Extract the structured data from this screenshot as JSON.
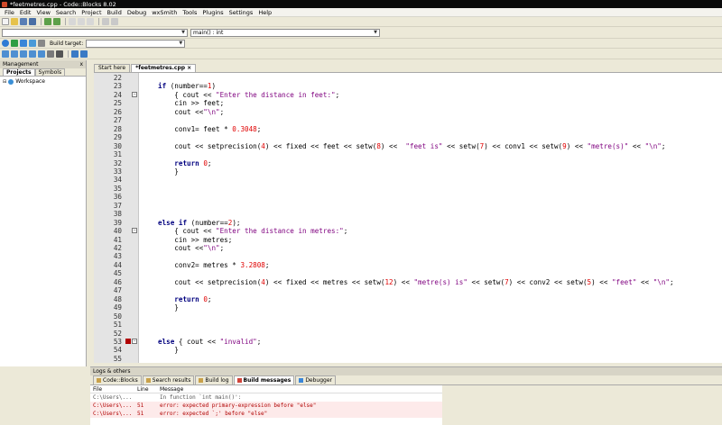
{
  "window": {
    "title": "*feetmetres.cpp - Code::Blocks 8.02"
  },
  "menu": [
    "File",
    "Edit",
    "View",
    "Search",
    "Project",
    "Build",
    "Debug",
    "wxSmith",
    "Tools",
    "Plugins",
    "Settings",
    "Help"
  ],
  "toolbar": {
    "build_target_label": "Build target:",
    "symbol_combo": "main() : int"
  },
  "management": {
    "title": "Management",
    "close": "x",
    "tabs": [
      "Projects",
      "Symbols"
    ],
    "workspace": "Workspace"
  },
  "editor": {
    "tabs": [
      {
        "label": "Start here"
      },
      {
        "label": "*feetmetres.cpp ×"
      }
    ],
    "lines": [
      {
        "n": "22",
        "t": ""
      },
      {
        "n": "23",
        "t": "if (number==1)"
      },
      {
        "n": "24",
        "t": "    { cout << \"Enter the distance in feet:\";"
      },
      {
        "n": "25",
        "t": "    cin >> feet;"
      },
      {
        "n": "26",
        "t": "    cout <<\"\\n\";"
      },
      {
        "n": "27",
        "t": ""
      },
      {
        "n": "28",
        "t": "    conv1= feet * 0.3048;"
      },
      {
        "n": "29",
        "t": ""
      },
      {
        "n": "30",
        "t": "    cout << setprecision(4) << fixed << feet << setw(8) <<  \"feet is\" << setw(7) << conv1 << setw(9) << \"metre(s)\" << \"\\n\";"
      },
      {
        "n": "31",
        "t": ""
      },
      {
        "n": "32",
        "t": "    return 0;"
      },
      {
        "n": "33",
        "t": "    }"
      },
      {
        "n": "34",
        "t": ""
      },
      {
        "n": "35",
        "t": ""
      },
      {
        "n": "36",
        "t": ""
      },
      {
        "n": "37",
        "t": ""
      },
      {
        "n": "38",
        "t": ""
      },
      {
        "n": "39",
        "t": "else if (number==2);"
      },
      {
        "n": "40",
        "t": "    { cout << \"Enter the distance in metres:\";"
      },
      {
        "n": "41",
        "t": "    cin >> metres;"
      },
      {
        "n": "42",
        "t": "    cout <<\"\\n\";"
      },
      {
        "n": "43",
        "t": ""
      },
      {
        "n": "44",
        "t": "    conv2= metres * 3.2808;"
      },
      {
        "n": "45",
        "t": ""
      },
      {
        "n": "46",
        "t": "    cout << setprecision(4) << fixed << metres << setw(12) << \"metre(s) is\" << setw(7) << conv2 << setw(5) << \"feet\" << \"\\n\";"
      },
      {
        "n": "47",
        "t": ""
      },
      {
        "n": "48",
        "t": "    return 0;"
      },
      {
        "n": "49",
        "t": "    }"
      },
      {
        "n": "50",
        "t": ""
      },
      {
        "n": "51",
        "t": ""
      },
      {
        "n": "52",
        "t": ""
      },
      {
        "n": "53",
        "t": "else { cout << \"invalid\";"
      },
      {
        "n": "54",
        "t": "    }"
      },
      {
        "n": "55",
        "t": ""
      }
    ]
  },
  "logs": {
    "title": "Logs & others",
    "tabs": [
      "Code::Blocks",
      "Search results",
      "Build log",
      "Build messages",
      "Debugger"
    ],
    "headers": [
      "File",
      "Line",
      "Message"
    ],
    "rows": [
      {
        "file": "C:\\Users\\...",
        "line": "",
        "msg": "In function `int main()':",
        "kind": "info"
      },
      {
        "file": "C:\\Users\\...",
        "line": "51",
        "msg": "error: expected primary-expression before \"else\"",
        "kind": "err"
      },
      {
        "file": "C:\\Users\\...",
        "line": "51",
        "msg": "error: expected `;' before \"else\"",
        "kind": "err"
      }
    ]
  }
}
